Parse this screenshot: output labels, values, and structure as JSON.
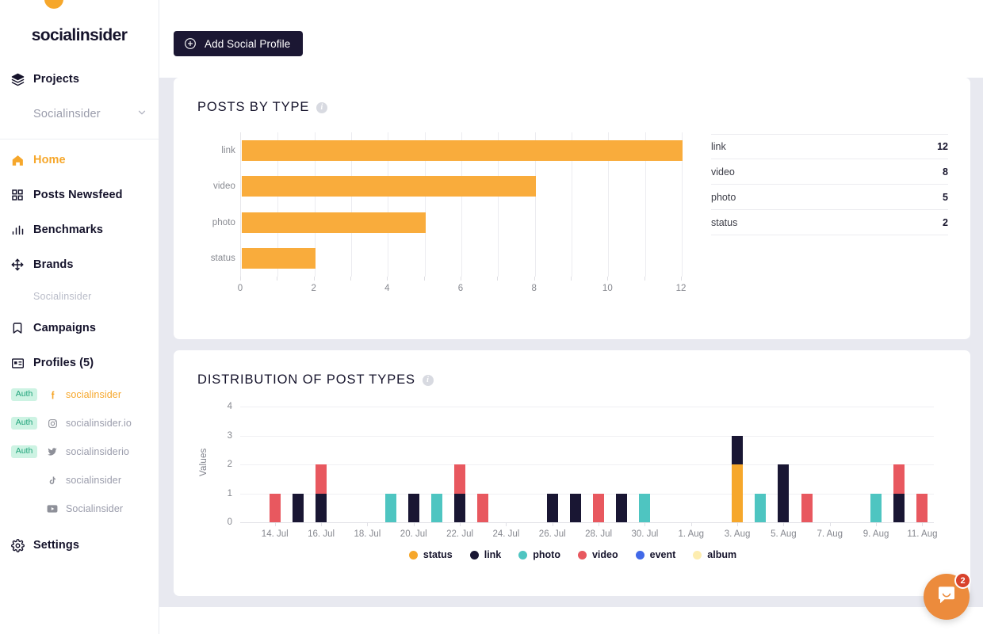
{
  "brand": {
    "logo_text": "socialinsider"
  },
  "sidebar": {
    "projects_label": "Projects",
    "project_selected": "Socialinsider",
    "nav": [
      {
        "label": "Home",
        "icon": "home-icon",
        "active": true
      },
      {
        "label": "Posts Newsfeed",
        "icon": "grid-icon",
        "active": false
      },
      {
        "label": "Benchmarks",
        "icon": "bar-chart-icon",
        "active": false
      },
      {
        "label": "Brands",
        "icon": "move-icon",
        "active": false
      }
    ],
    "group_label": "Socialinsider",
    "nav2": [
      {
        "label": "Campaigns",
        "icon": "bookmark-icon"
      },
      {
        "label": "Profiles (5)",
        "icon": "id-card-icon"
      }
    ],
    "profiles": [
      {
        "badge": "Auth",
        "network": "facebook-icon",
        "name": "socialinsider",
        "selected": true
      },
      {
        "badge": "Auth",
        "network": "instagram-icon",
        "name": "socialinsider.io",
        "selected": false
      },
      {
        "badge": "Auth",
        "network": "twitter-icon",
        "name": "socialinsiderio",
        "selected": false
      },
      {
        "badge": "",
        "network": "tiktok-icon",
        "name": "socialinsider",
        "selected": false
      },
      {
        "badge": "",
        "network": "youtube-icon",
        "name": "Socialinsider",
        "selected": false
      }
    ],
    "settings": {
      "label": "Settings",
      "icon": "gear-icon"
    }
  },
  "topbar": {
    "add_profile_label": "Add Social Profile",
    "add_icon": "plus-circle-icon"
  },
  "cards": {
    "posts_by_type": {
      "title": "POSTS BY TYPE",
      "info_icon": "info-icon"
    },
    "distribution": {
      "title": "DISTRIBUTION OF POST TYPES",
      "info_icon": "info-icon"
    }
  },
  "chat": {
    "badge": "2",
    "icon": "chat-bubble-icon"
  },
  "colors": {
    "accent": "#f6a72b",
    "bar": "#f9ac3c",
    "dark": "#1b1733",
    "status": "#f6a72b",
    "link": "#191633",
    "photo": "#4ec5c1",
    "video": "#e8585f",
    "event": "#4169e8",
    "album": "#fdedb0",
    "auth_badge_bg": "#cdf3e3",
    "auth_badge_fg": "#1fa37a",
    "page_bg": "#e8e9f0"
  },
  "chart_data": [
    {
      "id": "posts_by_type",
      "type": "bar",
      "orientation": "horizontal",
      "title": "POSTS BY TYPE",
      "categories": [
        "link",
        "video",
        "photo",
        "status"
      ],
      "values": [
        12,
        8,
        5,
        2
      ],
      "xlabel": "",
      "ylabel": "",
      "xlim": [
        0,
        12
      ],
      "xticks": [
        0,
        1,
        2,
        3,
        4,
        5,
        6,
        7,
        8,
        9,
        10,
        11,
        12
      ],
      "xtick_labels": [
        "0",
        "",
        "2",
        "",
        "4",
        "",
        "6",
        "",
        "8",
        "",
        "10",
        "",
        "12"
      ],
      "grid": true,
      "legend": false,
      "color": "#f9ac3c",
      "table": {
        "rows": [
          {
            "label": "link",
            "value": "12"
          },
          {
            "label": "video",
            "value": "8"
          },
          {
            "label": "photo",
            "value": "5"
          },
          {
            "label": "status",
            "value": "2"
          }
        ]
      }
    },
    {
      "id": "distribution_of_post_types",
      "type": "bar",
      "stacked": true,
      "orientation": "vertical",
      "title": "DISTRIBUTION OF POST TYPES",
      "xlabel": "",
      "ylabel": "Values",
      "ylim": [
        0,
        4
      ],
      "yticks": [
        0,
        1,
        2,
        3,
        4
      ],
      "grid": true,
      "legend": true,
      "legend_position": "bottom",
      "legend_entries": [
        {
          "name": "status",
          "color": "#f6a72b"
        },
        {
          "name": "link",
          "color": "#191633"
        },
        {
          "name": "photo",
          "color": "#4ec5c1"
        },
        {
          "name": "video",
          "color": "#e8585f"
        },
        {
          "name": "event",
          "color": "#4169e8"
        },
        {
          "name": "album",
          "color": "#fdedb0"
        }
      ],
      "x": [
        "13. Jul",
        "14. Jul",
        "15. Jul",
        "16. Jul",
        "17. Jul",
        "18. Jul",
        "19. Jul",
        "20. Jul",
        "21. Jul",
        "22. Jul",
        "23. Jul",
        "24. Jul",
        "25. Jul",
        "26. Jul",
        "27. Jul",
        "28. Jul",
        "29. Jul",
        "30. Jul",
        "31. Jul",
        "1. Aug",
        "2. Aug",
        "3. Aug",
        "4. Aug",
        "5. Aug",
        "6. Aug",
        "7. Aug",
        "8. Aug",
        "9. Aug",
        "10. Aug",
        "11. Aug"
      ],
      "xtick_labels": [
        "14. Jul",
        "16. Jul",
        "18. Jul",
        "20. Jul",
        "22. Jul",
        "24. Jul",
        "26. Jul",
        "28. Jul",
        "30. Jul",
        "1. Aug",
        "3. Aug",
        "5. Aug",
        "7. Aug",
        "9. Aug",
        "11. Aug"
      ],
      "series": [
        {
          "name": "status",
          "color": "#f6a72b",
          "values": [
            0,
            0,
            0,
            0,
            0,
            0,
            0,
            0,
            0,
            0,
            0,
            0,
            0,
            0,
            0,
            0,
            0,
            0,
            0,
            0,
            0,
            2,
            0,
            0,
            0,
            0,
            0,
            0,
            0,
            0
          ]
        },
        {
          "name": "link",
          "color": "#191633",
          "values": [
            0,
            0,
            1,
            1,
            0,
            0,
            0,
            1,
            0,
            1,
            0,
            0,
            0,
            1,
            1,
            0,
            1,
            0,
            0,
            0,
            0,
            1,
            0,
            2,
            0,
            0,
            0,
            0,
            1,
            0
          ]
        },
        {
          "name": "photo",
          "color": "#4ec5c1",
          "values": [
            0,
            0,
            0,
            0,
            0,
            0,
            1,
            0,
            1,
            0,
            0,
            0,
            0,
            0,
            0,
            0,
            0,
            1,
            0,
            0,
            0,
            0,
            1,
            0,
            0,
            0,
            0,
            1,
            0,
            0
          ]
        },
        {
          "name": "video",
          "color": "#e8585f",
          "values": [
            0,
            1,
            0,
            1,
            0,
            0,
            0,
            0,
            0,
            1,
            1,
            0,
            0,
            0,
            0,
            1,
            0,
            0,
            0,
            0,
            0,
            0,
            0,
            0,
            1,
            0,
            0,
            0,
            1,
            1
          ]
        },
        {
          "name": "event",
          "color": "#4169e8",
          "values": [
            0,
            0,
            0,
            0,
            0,
            0,
            0,
            0,
            0,
            0,
            0,
            0,
            0,
            0,
            0,
            0,
            0,
            0,
            0,
            0,
            0,
            0,
            0,
            0,
            0,
            0,
            0,
            0,
            0,
            0
          ]
        },
        {
          "name": "album",
          "color": "#fdedb0",
          "values": [
            0,
            0,
            0,
            0,
            0,
            0,
            0,
            0,
            0,
            0,
            0,
            0,
            0,
            0,
            0,
            0,
            0,
            0,
            0,
            0,
            0,
            0,
            0,
            0,
            0,
            0,
            0,
            0,
            0,
            0
          ]
        }
      ]
    }
  ]
}
